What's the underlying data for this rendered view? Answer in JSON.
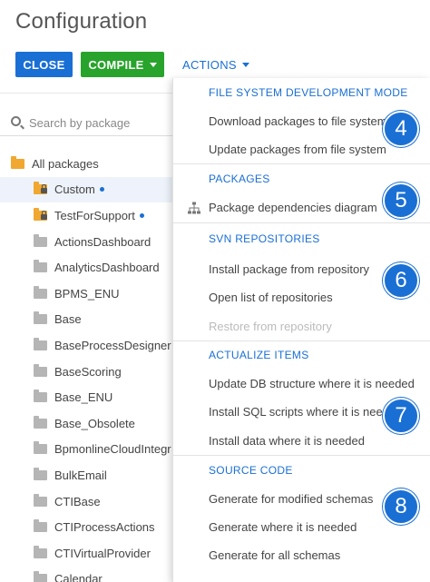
{
  "page": {
    "title": "Configuration"
  },
  "toolbar": {
    "close_label": "CLOSE",
    "compile_label": "COMPILE",
    "actions_label": "ACTIONS"
  },
  "search": {
    "placeholder": "Search by package"
  },
  "tree": {
    "root_label": "All packages",
    "items": [
      {
        "label": "Custom",
        "icon": "folder-locked-icon",
        "dot": true,
        "selected": true
      },
      {
        "label": "TestForSupport",
        "icon": "folder-locked-icon",
        "dot": true
      },
      {
        "label": "ActionsDashboard",
        "icon": "folder-icon"
      },
      {
        "label": "AnalyticsDashboard",
        "icon": "folder-icon"
      },
      {
        "label": "BPMS_ENU",
        "icon": "folder-icon"
      },
      {
        "label": "Base",
        "icon": "folder-icon"
      },
      {
        "label": "BaseProcessDesigner",
        "icon": "folder-icon"
      },
      {
        "label": "BaseScoring",
        "icon": "folder-icon"
      },
      {
        "label": "Base_ENU",
        "icon": "folder-icon"
      },
      {
        "label": "Base_Obsolete",
        "icon": "folder-icon"
      },
      {
        "label": "BpmonlineCloudIntegr",
        "icon": "folder-icon"
      },
      {
        "label": "BulkEmail",
        "icon": "folder-icon"
      },
      {
        "label": "CTIBase",
        "icon": "folder-icon"
      },
      {
        "label": "CTIProcessActions",
        "icon": "folder-icon"
      },
      {
        "label": "CTIVirtualProvider",
        "icon": "folder-icon"
      },
      {
        "label": "Calendar",
        "icon": "folder-icon"
      }
    ]
  },
  "menu": {
    "sections": [
      {
        "header": "FILE SYSTEM DEVELOPMENT MODE",
        "badge": "4",
        "items": [
          {
            "label": "Download packages to file system"
          },
          {
            "label": "Update packages from file system"
          }
        ]
      },
      {
        "header": "PACKAGES",
        "badge": "5",
        "items": [
          {
            "label": "Package dependencies diagram",
            "icon": "hierarchy-icon"
          }
        ]
      },
      {
        "header": "SVN REPOSITORIES",
        "badge": "6",
        "items": [
          {
            "label": "Install package from repository"
          },
          {
            "label": "Open list of repositories"
          },
          {
            "label": "Restore from repository",
            "disabled": true
          }
        ]
      },
      {
        "header": "ACTUALIZE ITEMS",
        "badge": "7",
        "items": [
          {
            "label": "Update DB structure where it is needed"
          },
          {
            "label": "Install SQL scripts where it is needed"
          },
          {
            "label": "Install data where it is needed"
          }
        ]
      },
      {
        "header": "SOURCE CODE",
        "badge": "8",
        "items": [
          {
            "label": "Generate for modified schemas"
          },
          {
            "label": "Generate where it is needed"
          },
          {
            "label": "Generate for all schemas"
          }
        ]
      }
    ]
  },
  "colors": {
    "accent": "#1a6fd4",
    "compile": "#28a32c",
    "folder": "#b5b5b5",
    "folder_custom": "#f0a830"
  }
}
